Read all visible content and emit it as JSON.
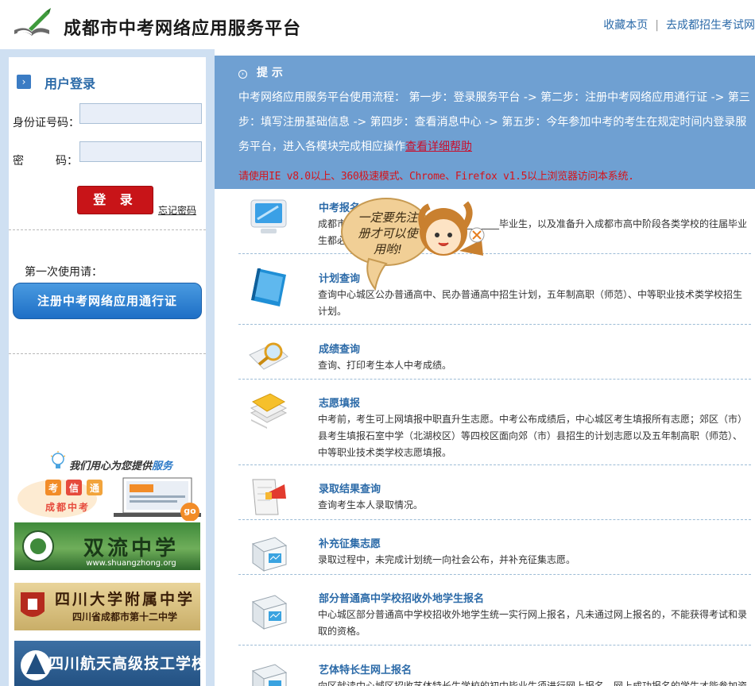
{
  "header": {
    "site_title": "成都市中考网络应用服务平台",
    "link_favorite": "收藏本页",
    "separator": "|",
    "link_zsks": "去成都招生考试网"
  },
  "login": {
    "title": "用户登录",
    "id_label": "身份证号码：",
    "id_value": "",
    "password_label_1": "密",
    "password_label_2": "码：",
    "password_value": "",
    "submit_label": "登 录",
    "forgot_label": "忘记密码",
    "first_use_label": "第一次使用请：",
    "register_label": "注册中考网络应用通行证"
  },
  "sidebar_ads": {
    "promo_slogan_prefix": "我们用心为您提供",
    "promo_slogan_emphasis": "服务",
    "promo_chars": [
      "考",
      "信",
      "通"
    ],
    "promo_sub": "成都中考",
    "promo_go": "go",
    "school1_name": "双流中学",
    "school1_url": "www.shuangzhong.org",
    "school2_name": "四川大学附属中学",
    "school2_sub": "四川省成都市第十二中学",
    "school3_name": "四川航天高级技工学校"
  },
  "notice": {
    "title": "提  示",
    "body": "中考网络应用服务平台使用流程： 第一步：登录服务平台 -> 第二步：注册中考网络应用通行证 -> 第三步：填写注册基础信息 -> 第四步：查看消息中心 -> 第五步：今年参加中考的考生在规定时间内登录服务平台，进入各模块完成相应操作",
    "help_link": "查看详细帮助",
    "browser_warning": "请使用IE v8.0以上、360极速模式、Chrome、Firefox v1.5以上浏览器访问本系统."
  },
  "mascot": {
    "bubble_text": "一定要先注册才可以使用哟!"
  },
  "modules": [
    {
      "title": "中考报名",
      "desc": "成都市________________________________毕业生，以及准备升入成都市高中阶段各类学校的往届毕业生都必须进行________",
      "icon": "monitor-icon"
    },
    {
      "title": "计划查询",
      "desc": "查询中心城区公办普通高中、民办普通高中招生计划，五年制高职（师范）、中等职业技术类学校招生计划。",
      "icon": "notebook-icon"
    },
    {
      "title": "成绩查询",
      "desc": "查询、打印考生本人中考成绩。",
      "icon": "magnifier-icon"
    },
    {
      "title": "志愿填报",
      "desc": "中考前，考生可上网填报中职直升生志愿。中考公布成绩后，中心城区考生填报所有志愿；郊区（市）县考生填报石室中学（北湖校区）等四校区面向郊（市）县招生的计划志愿以及五年制高职（师范）、中等职业技术类学校志愿填报。",
      "icon": "documents-icon"
    },
    {
      "title": "录取结果查询",
      "desc": "查询考生本人录取情况。",
      "icon": "megaphone-icon"
    },
    {
      "title": "补充征集志愿",
      "desc": "录取过程中，未完成计划统一向社会公布，并补充征集志愿。",
      "icon": "box-icon"
    },
    {
      "title": "部分普通高中学校招收外地学生报名",
      "desc": "中心城区部分普通高中学校招收外地学生统一实行网上报名，凡未通过网上报名的，不能获得考试和录取的资格。",
      "icon": "box-icon"
    },
    {
      "title": "艺体特长生网上报名",
      "desc": "向区就读中心城区招收艺体特长生学校的初中毕业生须进行网上报名，网上成功报名的学生才能参加资",
      "icon": "box-icon"
    }
  ],
  "colors": {
    "accent_blue": "#2b6aa8",
    "notice_bg": "#6fa0d2",
    "warning_red": "#d6141a",
    "login_red": "#c81418",
    "left_panel_bg": "#cfe0f2"
  }
}
